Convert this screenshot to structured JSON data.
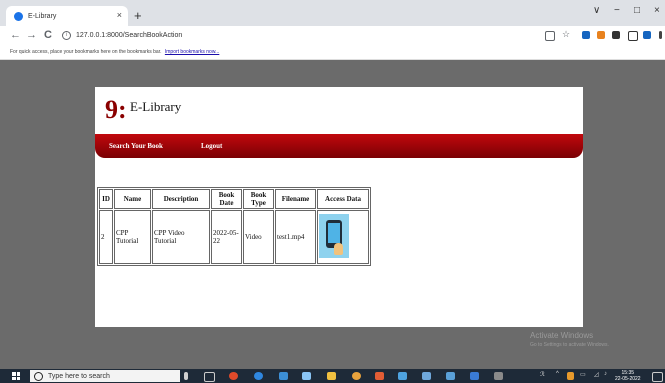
{
  "browser": {
    "tab_title": "E-Library",
    "tab_close": "×",
    "new_tab": "+",
    "url": "127.0.0.1:8000/SearchBookAction",
    "nav": {
      "back": "←",
      "forward": "→",
      "reload": "C"
    },
    "window": {
      "minimize": "∨",
      "restore": "−",
      "maximize": "□",
      "close": "×"
    },
    "bookmarks_text": "For quick access, place your bookmarks here on the bookmarks bar.",
    "bookmarks_link": "Import bookmarks now..."
  },
  "site": {
    "logo_glyph": "9:",
    "title": "E-Library",
    "nav": {
      "search": "Search Your Book",
      "logout": "Logout"
    }
  },
  "table": {
    "headers": {
      "id": "ID",
      "name": "Name",
      "description": "Description",
      "date": "Book Date",
      "type": "Book Type",
      "filename": "Filename",
      "access": "Access Data"
    },
    "rows": [
      {
        "id": "2",
        "name": "CPP Tutorial",
        "description": "CPP Video Tutorial",
        "date": "2022-05-22",
        "type": "Video",
        "filename": "test1.mp4"
      }
    ]
  },
  "watermark": {
    "line1": "Activate Windows",
    "line2": "Go to Settings to activate Windows."
  },
  "taskbar": {
    "search_placeholder": "Type here to search",
    "time": "15:35",
    "date": "22-05-2022"
  },
  "colors": {
    "accent": "#c1080d",
    "taskbar": "#1e2a38",
    "page_background": "#6b6b6b"
  }
}
